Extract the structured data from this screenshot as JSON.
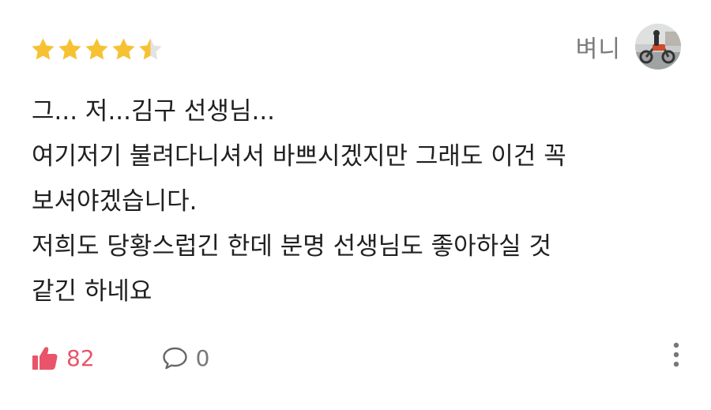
{
  "review": {
    "rating": 4.5,
    "rating_max": 5,
    "author": {
      "name": "벼니"
    },
    "text_lines": [
      "그... 저...김구 선생님...",
      "여기저기 불려다니셔서 바쁘시겠지만 그래도 이건 꼭",
      "보셔야겠습니다.",
      "저희도 당황스럽긴 한데 분명 선생님도 좋아하실 것",
      "같긴 하네요"
    ],
    "likes": "82",
    "comments": "0"
  },
  "colors": {
    "star_filled": "#f6c233",
    "star_empty": "#e3e3e3",
    "like_accent": "#e9546a",
    "muted_text": "#7a7a7a"
  },
  "icons": {
    "star": "star-icon",
    "like": "thumbs-up-icon",
    "comment": "speech-bubble-icon",
    "more": "vertical-ellipsis-icon"
  }
}
